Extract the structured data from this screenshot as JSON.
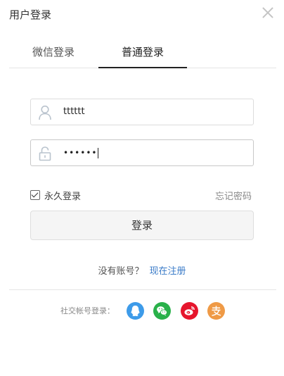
{
  "dialog": {
    "title": "用户登录"
  },
  "tabs": [
    {
      "label": "微信登录",
      "active": false
    },
    {
      "label": "普通登录",
      "active": true
    }
  ],
  "form": {
    "username": {
      "value": "tttttt",
      "icon": "user-icon"
    },
    "password": {
      "masked_value": "••••••",
      "icon": "lock-icon"
    },
    "remember_label": "永久登录",
    "remember_checked": true,
    "forgot_label": "忘记密码",
    "login_button": "登录"
  },
  "register": {
    "prompt": "没有账号？",
    "link": "现在注册"
  },
  "social": {
    "label": "社交帐号登录：",
    "providers": [
      {
        "name": "qq-icon",
        "color": "#3d9be9"
      },
      {
        "name": "wechat-icon",
        "color": "#29b14a"
      },
      {
        "name": "weibo-icon",
        "color": "#e6162d"
      },
      {
        "name": "alipay-icon",
        "color": "#ef9a46"
      }
    ]
  }
}
